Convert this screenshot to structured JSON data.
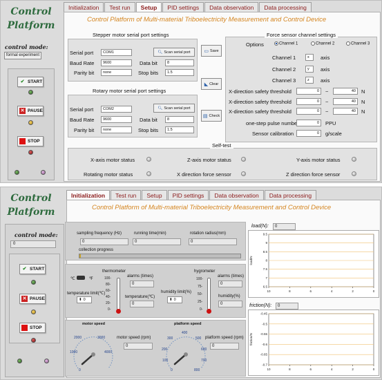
{
  "top": {
    "sidebar": {
      "logo_line1": "Control",
      "logo_line2": "Platform",
      "mode_label": "control mode:",
      "mode_value": "formal experiment",
      "start_label": "START",
      "pause_label": "PAUSE",
      "stop_label": "STOP"
    },
    "tabs": [
      "Initialization",
      "Test run",
      "Setup",
      "PID settings",
      "Data observation",
      "Data processing"
    ],
    "active_tab": "Setup",
    "header": "Control Platform of Multi-material Triboelectricity Measurement and Control Device",
    "stepper": {
      "title": "Stepper motor serial port settings",
      "serial_port_label": "Serial port",
      "serial_port_value": "COM1",
      "baud_label": "Baud Rate",
      "baud_value": "9600",
      "parity_label": "Parity bit",
      "parity_value": "none",
      "scan_label": "Scan serial port",
      "data_bit_label": "Data bit",
      "data_bit_value": "8",
      "stop_bits_label": "Stop bits",
      "stop_bits_value": "1.5"
    },
    "rotary": {
      "title": "Rotary  motor serial port settings",
      "serial_port_label": "Serial port",
      "serial_port_value": "COM2",
      "baud_label": "Baud Rate",
      "baud_value": "9600",
      "parity_label": "Parity bit",
      "parity_value": "none",
      "scan_label": "Scan serial port",
      "data_bit_label": "Data bit",
      "data_bit_value": "8",
      "stop_bits_label": "Stop bits",
      "stop_bits_value": "1.5"
    },
    "mid_buttons": {
      "save": "Save",
      "clear": "Clear",
      "check": "Check"
    },
    "force": {
      "title": "Force sensor channel settings",
      "options_label": "Options",
      "radios": [
        "Channel 1",
        "Channel 2",
        "Channel 3"
      ],
      "selected": "Channel 1",
      "channels": [
        {
          "label": "Channel 1",
          "value": "x",
          "unit": "axis"
        },
        {
          "label": "Channel 2",
          "value": "y",
          "unit": "axis"
        },
        {
          "label": "Channel 3",
          "value": "z",
          "unit": "axis"
        }
      ],
      "thresholds": [
        {
          "label": "X-direction safety threshold",
          "min": "0",
          "sep": "~",
          "max": "40",
          "unit": "N"
        },
        {
          "label": "X-direction safety threshold",
          "min": "0",
          "sep": "~",
          "max": "40",
          "unit": "N"
        },
        {
          "label": "X-direction safety threshold",
          "min": "0",
          "sep": "~",
          "max": "40",
          "unit": "N"
        }
      ],
      "pulse_label": "one-step pulse number",
      "pulse_value": "0",
      "pulse_unit": "PPU",
      "calib_label": "Sensor calibration",
      "calib_value": "0",
      "calib_unit": "g/scale"
    },
    "selftest": {
      "title": "Self-test",
      "items": [
        "X-axis motor status",
        "Z-axis motor status",
        "Y-axis motor status",
        "Rotating motor status",
        "X direction force sensor",
        "Z direction force sensor"
      ]
    }
  },
  "bottom": {
    "sidebar": {
      "logo_line1": "Control",
      "logo_line2": "Platform",
      "mode_label": "control mode:",
      "mode_value": "0",
      "start_label": "START",
      "pause_label": "PAUSE",
      "stop_label": "STOP"
    },
    "tabs": [
      "Initialization",
      "Test run",
      "Setup",
      "PID settings",
      "Data observation",
      "Data processing"
    ],
    "active_tab": "Initialization",
    "header": "Control Platform of Multi-material Triboelectricity Measurement and Control Device",
    "acq": {
      "freq_label": "sampling frequency  (Hz)",
      "freq_value": "0",
      "time_label": "running time(min)",
      "time_value": "0",
      "radius_label": "rotation radius(mm)",
      "radius_value": "0",
      "progress_label": "collection progress",
      "progress": 0.01
    },
    "thermo": {
      "c": "℃",
      "f": "℉",
      "title": "thermometer",
      "limit_label": "temperature limit(℃)",
      "limit_value": "0",
      "alarms_label": "alarms (times)",
      "alarms_value": "0",
      "temp_label": "temperature(℃)",
      "temp_value": "0",
      "scale": [
        "100-",
        "80-",
        "60-",
        "40-",
        "20-",
        "0-"
      ]
    },
    "hygro": {
      "title": "hygrometer",
      "limit_label": "humidity limit(%)",
      "limit_value": "0",
      "alarms_label": "alarms (times)",
      "alarms_value": "0",
      "hum_label": "humidity(%)",
      "hum_value": "0",
      "scale": [
        "100-",
        "75-",
        "50-",
        "25-",
        "0-"
      ]
    },
    "motor": {
      "title": "motor speed",
      "speed_label": "motor speed  (rpm)",
      "speed_value": "0",
      "ticks": [
        "0",
        "1000",
        "2000",
        "3000",
        "4000"
      ]
    },
    "platform": {
      "title": "platform speed",
      "speed_label": "platform speed  (rpm)",
      "speed_value": "0",
      "ticks": [
        "0",
        "100",
        "200",
        "300",
        "400",
        "500",
        "600",
        "700",
        "800"
      ]
    },
    "load": {
      "label": "load(N):",
      "value": "0",
      "ylabel": "load/N",
      "yticks": [
        "9.5",
        "9",
        "8.5",
        "8",
        "7.5",
        "7",
        "6.5"
      ],
      "xticks": [
        "10",
        "8",
        "6",
        "4",
        "2",
        "0"
      ]
    },
    "friction": {
      "label": "friction(N):",
      "value": "0",
      "ylabel": "friction/N",
      "yticks": [
        "-0.45",
        "-0.5",
        "-0.55",
        "-0.6",
        "-0.65",
        "-0.7"
      ],
      "xticks": [
        "10",
        "8",
        "6",
        "4",
        "2",
        "0"
      ]
    }
  }
}
